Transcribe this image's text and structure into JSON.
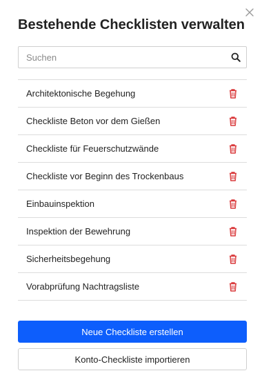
{
  "dialog": {
    "title": "Bestehende Checklisten verwalten"
  },
  "search": {
    "placeholder": "Suchen",
    "value": ""
  },
  "checklists": [
    {
      "label": "Architektonische Begehung"
    },
    {
      "label": "Checkliste Beton vor dem Gießen"
    },
    {
      "label": "Checkliste für Feuerschutzwände"
    },
    {
      "label": "Checkliste vor Beginn des Trockenbaus"
    },
    {
      "label": "Einbauinspektion"
    },
    {
      "label": "Inspektion der Bewehrung"
    },
    {
      "label": "Sicherheitsbegehung"
    },
    {
      "label": "Vorabprüfung Nachtragsliste"
    }
  ],
  "buttons": {
    "create": "Neue Checkliste erstellen",
    "import": "Konto-Checkliste importieren"
  },
  "colors": {
    "primary": "#0d5efc",
    "danger": "#d9383a",
    "border": "#dcdcdc"
  },
  "icons": {
    "close": "close-icon",
    "search": "search-icon",
    "delete": "trash-icon"
  }
}
